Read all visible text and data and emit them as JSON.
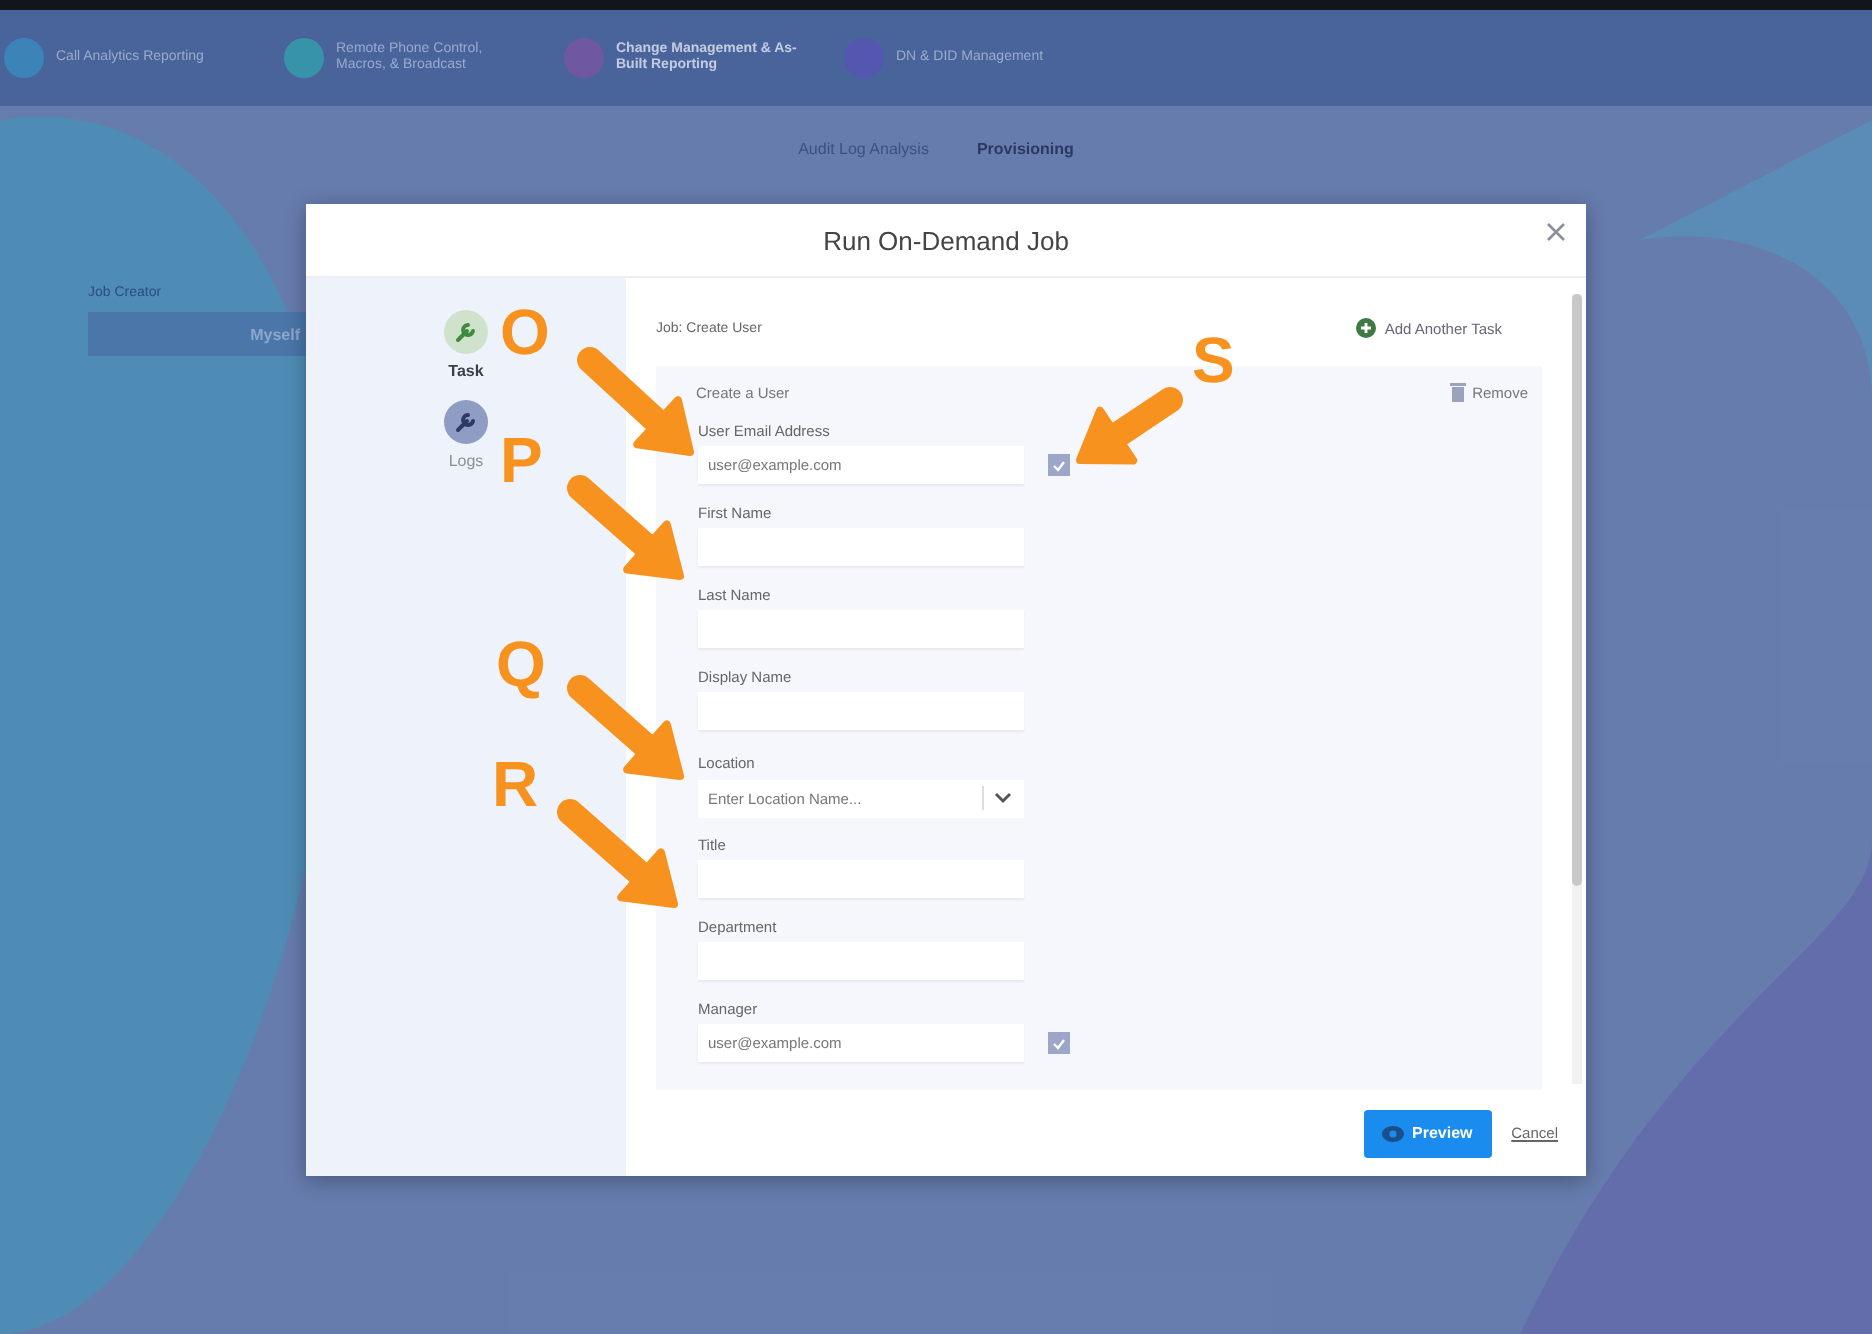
{
  "nav": {
    "items": [
      {
        "label": "Call Analytics Reporting",
        "color": "#3f8fc0"
      },
      {
        "label": "Remote Phone Control, Macros, & Broadcast",
        "color": "#3aa0b0"
      },
      {
        "label": "Change Management & As-Built Reporting",
        "color": "#7a5ca8",
        "selected": true
      },
      {
        "label": "DN & DID Management",
        "color": "#5a5ab8",
        "selected": false
      }
    ]
  },
  "tabs": [
    {
      "label": "Audit Log Analysis",
      "selected": false
    },
    {
      "label": "Provisioning",
      "selected": true
    }
  ],
  "background": {
    "job_creator_label": "Job Creator",
    "creator_button": "Myself"
  },
  "modal": {
    "title": "Run On-Demand Job",
    "steps": [
      {
        "label": "Task",
        "selected": true
      },
      {
        "label": "Logs",
        "selected": false
      }
    ],
    "job_label": "Job: Create User",
    "add_task": "Add Another Task",
    "task": {
      "title": "Create a User",
      "remove": "Remove",
      "fields": [
        {
          "kind": "checkable",
          "label": "User Email Address",
          "placeholder": "user@example.com",
          "checked": true
        },
        {
          "kind": "text",
          "label": "First Name"
        },
        {
          "kind": "text",
          "label": "Last Name"
        },
        {
          "kind": "text",
          "label": "Display Name"
        },
        {
          "kind": "select",
          "label": "Location",
          "placeholder": "Enter Location Name..."
        },
        {
          "kind": "text",
          "label": "Title"
        },
        {
          "kind": "text",
          "label": "Department"
        },
        {
          "kind": "checkable",
          "label": "Manager",
          "placeholder": "user@example.com",
          "checked": true
        }
      ]
    },
    "preview": "Preview",
    "cancel": "Cancel"
  },
  "annotations": [
    {
      "letter": "O"
    },
    {
      "letter": "P"
    },
    {
      "letter": "Q"
    },
    {
      "letter": "R"
    },
    {
      "letter": "S"
    }
  ]
}
